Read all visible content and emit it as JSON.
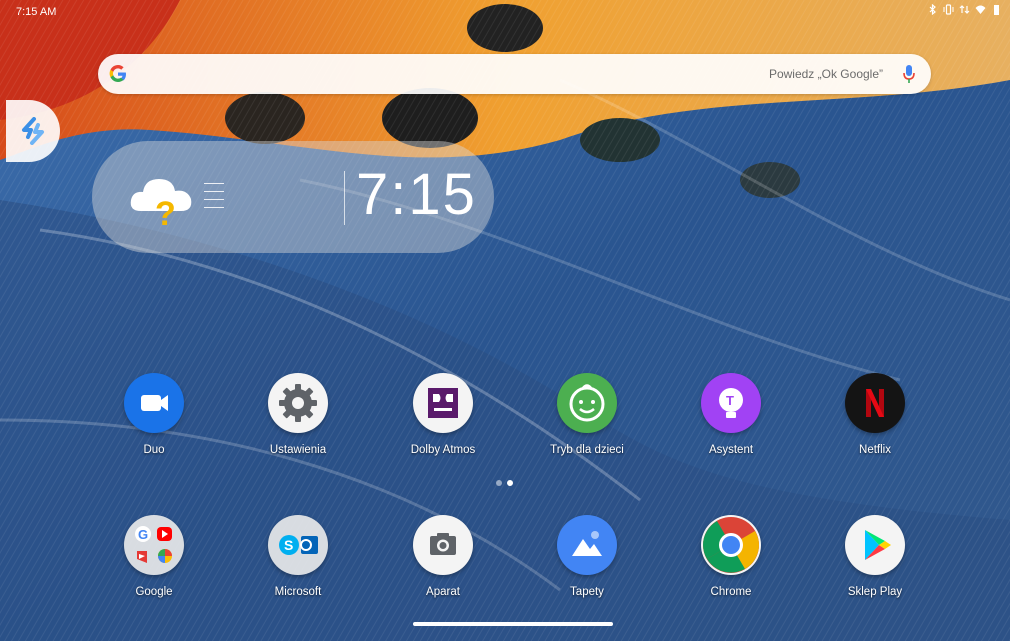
{
  "status_bar": {
    "time": "7:15 AM",
    "icons": [
      "bluetooth-icon",
      "vibrate-icon",
      "data-arrows-icon",
      "wifi-icon",
      "battery-icon"
    ]
  },
  "search": {
    "hint": "Powiedz „Ok Google”",
    "icon_left": "google-g-icon",
    "icon_right": "microphone-icon"
  },
  "side_panel": {
    "icon": "lenovo-shortcut-icon"
  },
  "clock_widget": {
    "time": "7:15",
    "weather_icon": "cloud-question-icon"
  },
  "apps": {
    "row1": [
      {
        "label": "Duo",
        "icon": "duo-video-icon"
      },
      {
        "label": "Ustawienia",
        "icon": "settings-gear-icon"
      },
      {
        "label": "Dolby Atmos",
        "icon": "dolby-atmos-icon"
      },
      {
        "label": "Tryb dla dzieci",
        "icon": "kids-mode-icon"
      },
      {
        "label": "Asystent",
        "icon": "assistant-icon"
      },
      {
        "label": "Netflix",
        "icon": "netflix-icon"
      }
    ],
    "row2": [
      {
        "label": "Google",
        "icon": "google-folder-icon"
      },
      {
        "label": "Microsoft",
        "icon": "microsoft-folder-icon"
      },
      {
        "label": "Aparat",
        "icon": "camera-icon"
      },
      {
        "label": "Tapety",
        "icon": "wallpapers-icon"
      },
      {
        "label": "Chrome",
        "icon": "chrome-icon"
      },
      {
        "label": "Sklep Play",
        "icon": "play-store-icon"
      }
    ]
  },
  "page_indicator": {
    "pages": 2,
    "current": 2
  },
  "colors": {
    "duo": "#1a73e8",
    "assistant": "#a142f4",
    "kids": "#4caf50",
    "netflix": "#e50914"
  }
}
